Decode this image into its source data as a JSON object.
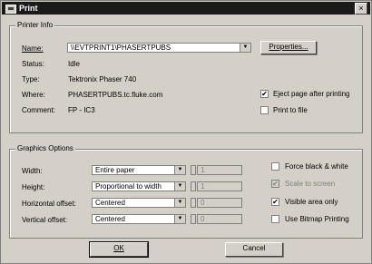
{
  "dialog": {
    "title": "Print",
    "close_glyph": "×"
  },
  "printer_info": {
    "group_label": "Printer Info",
    "name_label": "Name:",
    "name_value": "\\\\EVTPRINT1\\PHASERTPUBS",
    "properties_button": "Properties...",
    "status_label": "Status:",
    "status_value": "Idle",
    "type_label": "Type:",
    "type_value": "Tektronix Phaser 740",
    "where_label": "Where:",
    "where_value": "PHASERTPUBS.tc.fluke.com",
    "comment_label": "Comment:",
    "comment_value": "FP - IC3",
    "eject_label": "Eject page after printing",
    "eject_checked": true,
    "print_to_file_label": "Print to file",
    "print_to_file_checked": false
  },
  "graphics_options": {
    "group_label": "Graphics Options",
    "width_label": "Width:",
    "width_value": "Entire paper",
    "width_num": "1",
    "height_label": "Height:",
    "height_value": "Proportional to width",
    "height_num": "1",
    "hoffset_label": "Horizontal offset:",
    "hoffset_value": "Centered",
    "hoffset_num": "0",
    "voffset_label": "Vertical offset:",
    "voffset_value": "Centered",
    "voffset_num": "0",
    "force_bw_label": "Force black & white",
    "force_bw_checked": false,
    "scale_to_screen_label": "Scale to screen",
    "scale_to_screen_checked": true,
    "visible_area_label": "Visible area only",
    "visible_area_checked": true,
    "bitmap_label": "Use Bitmap Printing",
    "bitmap_checked": false
  },
  "footer": {
    "ok_button": "OK",
    "cancel_button": "Cancel"
  },
  "icons": {
    "checkmark": "✔",
    "dropdown": "▼",
    "spin_up": "▲",
    "spin_down": "▼"
  }
}
